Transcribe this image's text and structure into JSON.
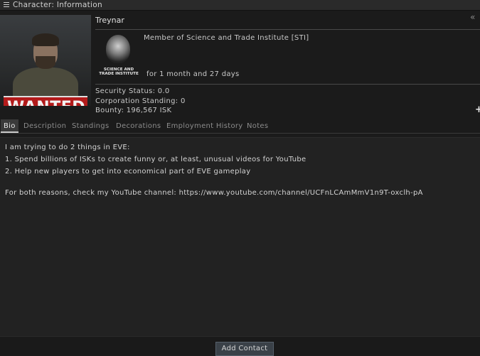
{
  "window": {
    "title": "Character: Information"
  },
  "character": {
    "name": "Treynar",
    "wanted_label": "WANTED",
    "membership": "Member of Science and Trade Institute [STI]",
    "corp_logo_caption": "SCIENCE AND TRADE INSTITUTE",
    "duration": "for 1 month and 27 days",
    "security_status": "Security Status: 0.0",
    "corporation_standing": "Corporation Standing: 0",
    "bounty": "Bounty: 196,567 ISK"
  },
  "tabs": [
    {
      "label": "Bio",
      "active": true
    },
    {
      "label": "Description",
      "active": false
    },
    {
      "label": "Standings",
      "active": false
    },
    {
      "label": "Decorations",
      "active": false
    },
    {
      "label": "Employment History",
      "active": false
    },
    {
      "label": "Notes",
      "active": false
    }
  ],
  "bio": {
    "lines": [
      "I am trying to do 2 things in EVE:",
      "1. Spend billions of ISKs to create funny or, at least, unusual videos for YouTube",
      "2. Help new players to get into economical part of EVE gameplay",
      "For both reasons, check my YouTube channel: https://www.youtube.com/channel/UCFnLCAmMmV1n9T-oxclh-pA"
    ]
  },
  "buttons": {
    "add_contact": "Add Contact"
  },
  "icons": {
    "menu": "menu-icon",
    "collapse": "double-chevron-left-icon",
    "plus": "plus-icon"
  },
  "colors": {
    "wanted_red": "#b31b1b",
    "panel": "#222222",
    "background": "#1b1b1b"
  }
}
